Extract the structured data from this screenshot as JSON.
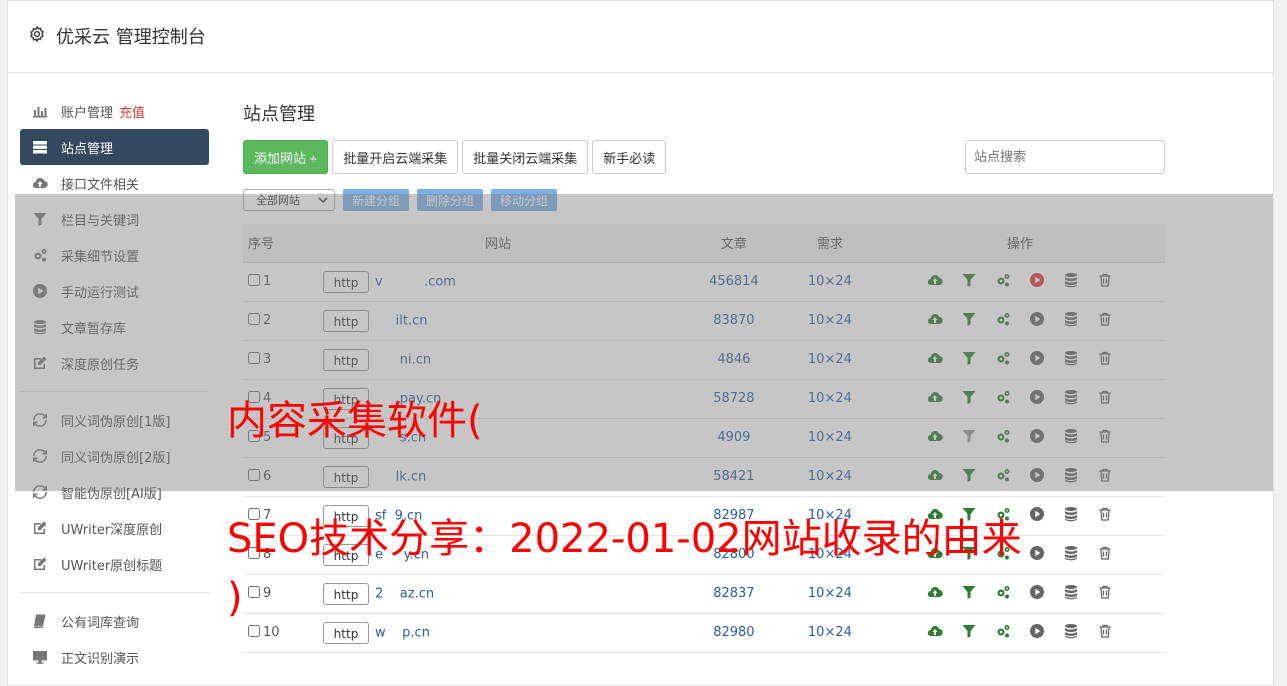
{
  "app": {
    "title": "优采云 管理控制台"
  },
  "sidebar": {
    "items": [
      {
        "label": "账户管理",
        "extra": "充值",
        "icon": "bar-chart-icon"
      },
      {
        "label": "站点管理",
        "icon": "server-icon",
        "active": true
      },
      {
        "label": "接口文件相关",
        "icon": "cloud-upload-icon"
      },
      {
        "label": "栏目与关键词",
        "icon": "filter-icon"
      },
      {
        "label": "采集细节设置",
        "icon": "gears-icon"
      },
      {
        "label": "手动运行测试",
        "icon": "play-circle-icon"
      },
      {
        "label": "文章暂存库",
        "icon": "database-icon"
      },
      {
        "label": "深度原创任务",
        "icon": "edit-icon"
      }
    ],
    "items2": [
      {
        "label": "同义词伪原创[1版]",
        "icon": "refresh-icon"
      },
      {
        "label": "同义词伪原创[2版]",
        "icon": "refresh-icon"
      },
      {
        "label": "智能伪原创[AI版]",
        "icon": "refresh-icon"
      },
      {
        "label": "UWriter深度原创",
        "icon": "edit-icon"
      },
      {
        "label": "UWriter原创标题",
        "icon": "edit-icon"
      }
    ],
    "items3": [
      {
        "label": "公有词库查询",
        "icon": "book-icon"
      },
      {
        "label": "正文识别演示",
        "icon": "monitor-icon"
      }
    ]
  },
  "main": {
    "title": "站点管理",
    "toolbar": {
      "add": "添加网站 +",
      "batch_open": "批量开启云端采集",
      "batch_close": "批量关闭云端采集",
      "guide": "新手必读"
    },
    "search_placeholder": "站点搜索",
    "group_select": "全部网站",
    "group_buttons": {
      "new": "新建分组",
      "delete": "删除分组",
      "move": "移动分组"
    },
    "table": {
      "headers": {
        "no": "序号",
        "site": "网站",
        "articles": "文章",
        "demand": "需求",
        "ops": "操作"
      },
      "protocol": "http",
      "rows": [
        {
          "no": "1",
          "site": "v          .com",
          "articles": "456814",
          "demand": "10×24",
          "play_active": true,
          "filter_dim": false
        },
        {
          "no": "2",
          "site": "     ilt.cn",
          "articles": "83870",
          "demand": "10×24",
          "play_active": false,
          "filter_dim": false
        },
        {
          "no": "3",
          "site": "      ni.cn",
          "articles": "4846",
          "demand": "10×24",
          "play_active": false,
          "filter_dim": false
        },
        {
          "no": "4",
          "site": "      pay.cn",
          "articles": "58728",
          "demand": "10×24",
          "play_active": false,
          "filter_dim": false
        },
        {
          "no": "5",
          "site": "      s.cn",
          "articles": "4909",
          "demand": "10×24",
          "play_active": false,
          "filter_dim": true
        },
        {
          "no": "6",
          "site": "     lk.cn",
          "articles": "58421",
          "demand": "10×24",
          "play_active": false,
          "filter_dim": false
        },
        {
          "no": "7",
          "site": "sf  9.cn",
          "articles": "82987",
          "demand": "10×24",
          "play_active": false,
          "filter_dim": false
        },
        {
          "no": "8",
          "site": "e     y.cn",
          "articles": "82800",
          "demand": "10×24",
          "play_active": false,
          "filter_dim": false
        },
        {
          "no": "9",
          "site": "2    az.cn",
          "articles": "82837",
          "demand": "10×24",
          "play_active": false,
          "filter_dim": false
        },
        {
          "no": "10",
          "site": "w    p.cn",
          "articles": "82980",
          "demand": "10×24",
          "play_active": false,
          "filter_dim": false
        }
      ]
    }
  },
  "watermark": {
    "line1": "内容采集软件(",
    "line2": "SEO技术分享：2022-01-02网站收录的由来",
    "line3": ")"
  },
  "colors": {
    "active_nav": "#34495e",
    "add_button": "#5cb85c",
    "group_button": "#7ab0e6",
    "link": "#2a5d9f",
    "watermark": "#ff0000"
  }
}
